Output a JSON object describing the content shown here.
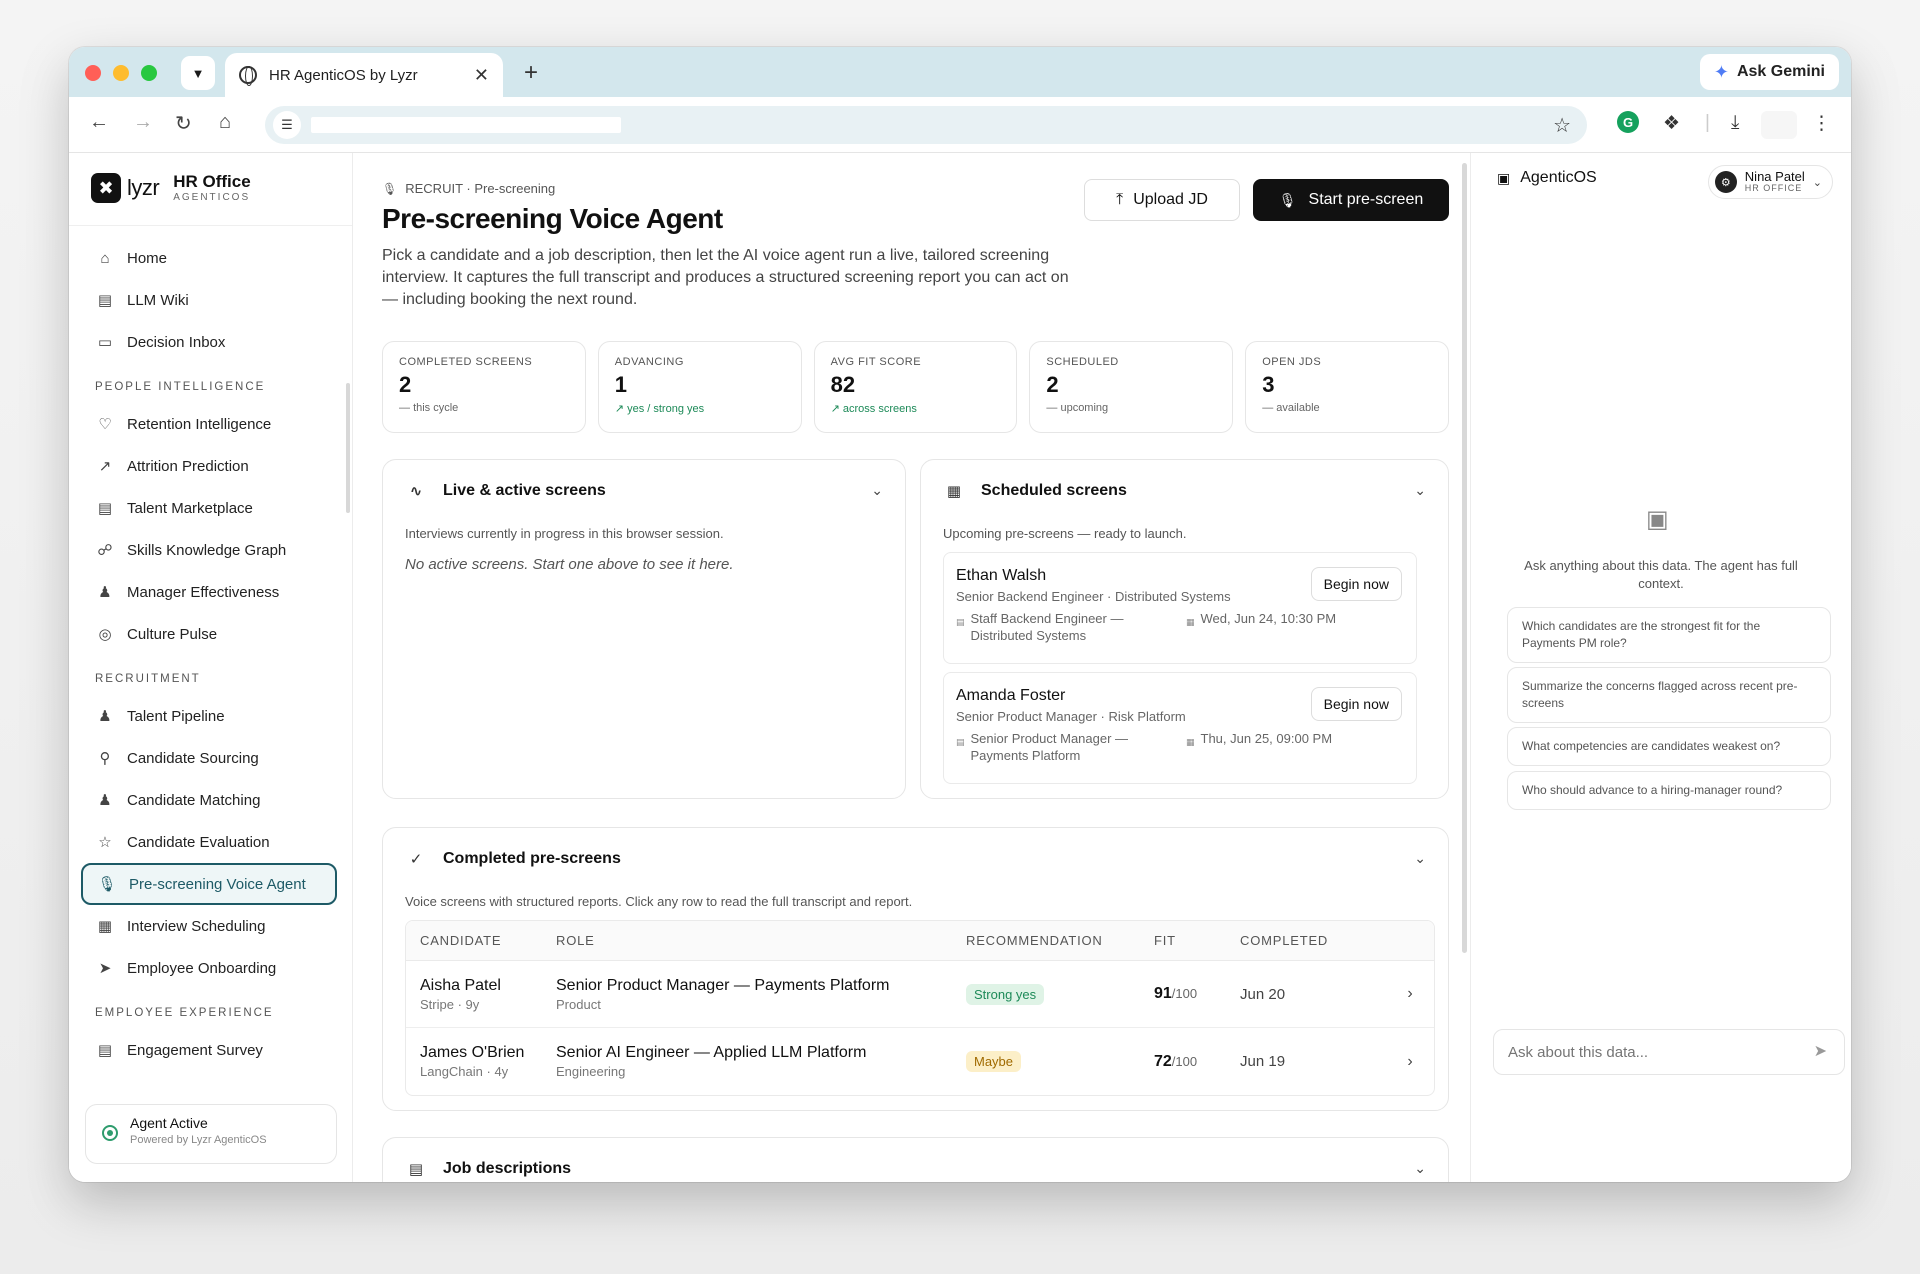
{
  "browser": {
    "tab_title": "HR AgenticOS by Lyzr",
    "gemini_label": "Ask Gemini"
  },
  "brand": {
    "logo_text": "lyzr",
    "product": "HR Office",
    "product_sub": "AGENTICOS"
  },
  "sidebar": {
    "top_items": [
      {
        "label": "Home",
        "icon": "home-icon"
      },
      {
        "label": "LLM Wiki",
        "icon": "book-icon"
      },
      {
        "label": "Decision Inbox",
        "icon": "inbox-icon"
      }
    ],
    "people_section": "PEOPLE INTELLIGENCE",
    "people_items": [
      {
        "label": "Retention Intelligence",
        "icon": "heart-pulse-icon"
      },
      {
        "label": "Attrition Prediction",
        "icon": "trending-icon"
      },
      {
        "label": "Talent Marketplace",
        "icon": "store-icon"
      },
      {
        "label": "Skills Knowledge Graph",
        "icon": "graph-icon"
      },
      {
        "label": "Manager Effectiveness",
        "icon": "users-icon"
      },
      {
        "label": "Culture Pulse",
        "icon": "radar-icon"
      }
    ],
    "recruit_section": "RECRUITMENT",
    "recruit_items": [
      {
        "label": "Talent Pipeline",
        "icon": "users-icon"
      },
      {
        "label": "Candidate Sourcing",
        "icon": "search-icon"
      },
      {
        "label": "Candidate Matching",
        "icon": "user-check-icon"
      },
      {
        "label": "Candidate Evaluation",
        "icon": "award-icon"
      },
      {
        "label": "Pre-screening Voice Agent",
        "icon": "mic-icon"
      },
      {
        "label": "Interview Scheduling",
        "icon": "calendar-icon"
      },
      {
        "label": "Employee Onboarding",
        "icon": "send-icon"
      }
    ],
    "employee_section": "EMPLOYEE EXPERIENCE",
    "employee_items": [
      {
        "label": "Engagement Survey",
        "icon": "clipboard-icon"
      }
    ],
    "agent_status": "Agent Active",
    "agent_powered": "Powered by Lyzr AgenticOS"
  },
  "main": {
    "breadcrumb": "RECRUIT · Pre-screening",
    "title": "Pre-screening Voice Agent",
    "description": "Pick a candidate and a job description, then let the AI voice agent run a live, tailored screening interview. It captures the full transcript and produces a structured screening report you can act on — including booking the next round.",
    "upload_label": "Upload JD",
    "start_label": "Start pre-screen",
    "stats": [
      {
        "label": "COMPLETED SCREENS",
        "value": "2",
        "sub": "this cycle",
        "trend": "flat"
      },
      {
        "label": "ADVANCING",
        "value": "1",
        "sub": "yes / strong yes",
        "trend": "up"
      },
      {
        "label": "AVG FIT SCORE",
        "value": "82",
        "sub": "across screens",
        "trend": "up"
      },
      {
        "label": "SCHEDULED",
        "value": "2",
        "sub": "upcoming",
        "trend": "flat"
      },
      {
        "label": "OPEN JDS",
        "value": "3",
        "sub": "available",
        "trend": "flat"
      }
    ],
    "live": {
      "title": "Live & active screens",
      "desc": "Interviews currently in progress in this browser session.",
      "empty": "No active screens. Start one above to see it here."
    },
    "scheduled": {
      "title": "Scheduled screens",
      "desc": "Upcoming pre-screens — ready to launch.",
      "button_label": "Begin now",
      "items": [
        {
          "name": "Ethan Walsh",
          "role": "Senior Backend Engineer · Distributed Systems",
          "jd": "Staff Backend Engineer — Distributed Systems",
          "when": "Wed, Jun 24, 10:30 PM"
        },
        {
          "name": "Amanda Foster",
          "role": "Senior Product Manager · Risk Platform",
          "jd": "Senior Product Manager — Payments Platform",
          "when": "Thu, Jun 25, 09:00 PM"
        }
      ]
    },
    "completed": {
      "title": "Completed pre-screens",
      "desc": "Voice screens with structured reports. Click any row to read the full transcript and report.",
      "columns": [
        "CANDIDATE",
        "ROLE",
        "RECOMMENDATION",
        "FIT",
        "COMPLETED"
      ],
      "rows": [
        {
          "name": "Aisha Patel",
          "meta": "Stripe · 9y",
          "role": "Senior Product Manager — Payments Platform",
          "dept": "Product",
          "rec": "Strong yes",
          "rec_color": "green",
          "fit": "91",
          "fit_max": "/100",
          "date": "Jun 20"
        },
        {
          "name": "James O'Brien",
          "meta": "LangChain · 4y",
          "role": "Senior AI Engineer — Applied LLM Platform",
          "dept": "Engineering",
          "rec": "Maybe",
          "rec_color": "yellow",
          "fit": "72",
          "fit_max": "/100",
          "date": "Jun 19"
        }
      ]
    },
    "jd_title": "Job descriptions"
  },
  "rpanel": {
    "title": "AgenticOS",
    "user_name": "Nina Patel",
    "user_role": "HR OFFICE",
    "hint": "Ask anything about this data. The agent has full context.",
    "suggestions": [
      "Which candidates are the strongest fit for the Payments PM role?",
      "Summarize the concerns flagged across recent pre-screens",
      "What competencies are candidates weakest on?",
      "Who should advance to a hiring-manager round?"
    ],
    "input_placeholder": "Ask about this data..."
  }
}
